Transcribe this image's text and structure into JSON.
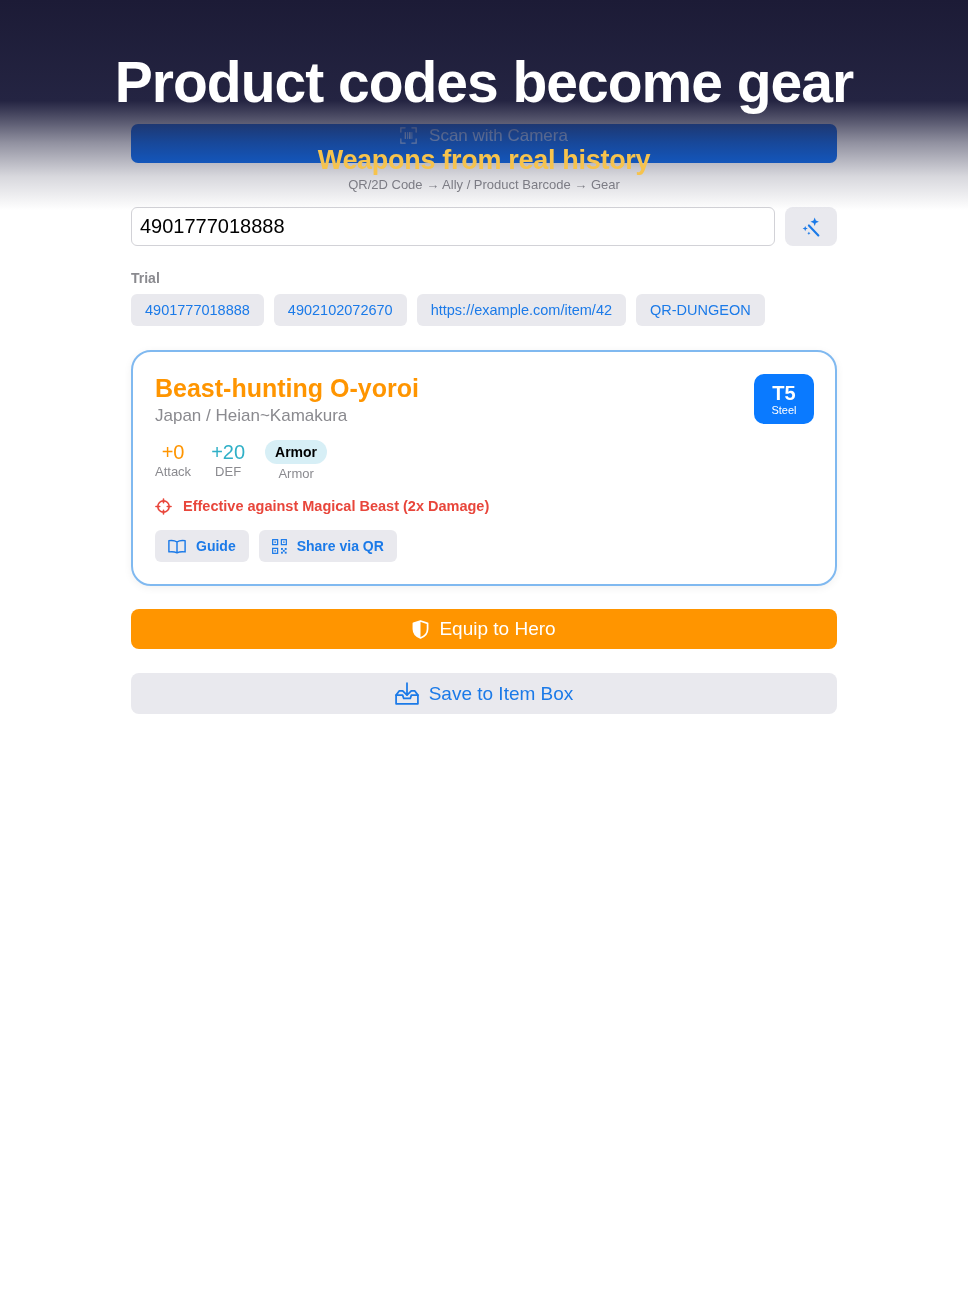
{
  "promo": {
    "headline": "Product codes become gear",
    "subtitle": "Weapons from real history"
  },
  "scan_button": {
    "label": "Scan with Camera"
  },
  "hint": "QR/2D Code → Ally / Product Barcode → Gear",
  "code_field": {
    "value": "4901777018888"
  },
  "trial": {
    "label": "Trial",
    "chips": [
      "4901777018888",
      "4902102072670",
      "https://example.com/item/42",
      "QR-DUNGEON"
    ]
  },
  "item_card": {
    "title": "Beast-hunting O-yoroi",
    "origin": "Japan / Heian~Kamakura",
    "tier": {
      "label": "T5",
      "material": "Steel"
    },
    "stats": [
      {
        "kind": "value",
        "value": "+0",
        "label": "Attack",
        "color": "#ff9500"
      },
      {
        "kind": "value",
        "value": "+20",
        "label": "DEF",
        "color": "#30b0c7"
      },
      {
        "kind": "tag",
        "value": "Armor",
        "label": "Armor",
        "color": "#d7eff6"
      }
    ],
    "effect": "Effective against Magical Beast (2x Damage)",
    "actions": [
      {
        "kind": "guide",
        "label": "Guide"
      },
      {
        "kind": "qr",
        "label": "Share via QR"
      }
    ]
  },
  "buttons": [
    {
      "kind": "primary",
      "label": "Equip to Hero"
    },
    {
      "kind": "secondary",
      "label": "Save to Item Box"
    }
  ]
}
